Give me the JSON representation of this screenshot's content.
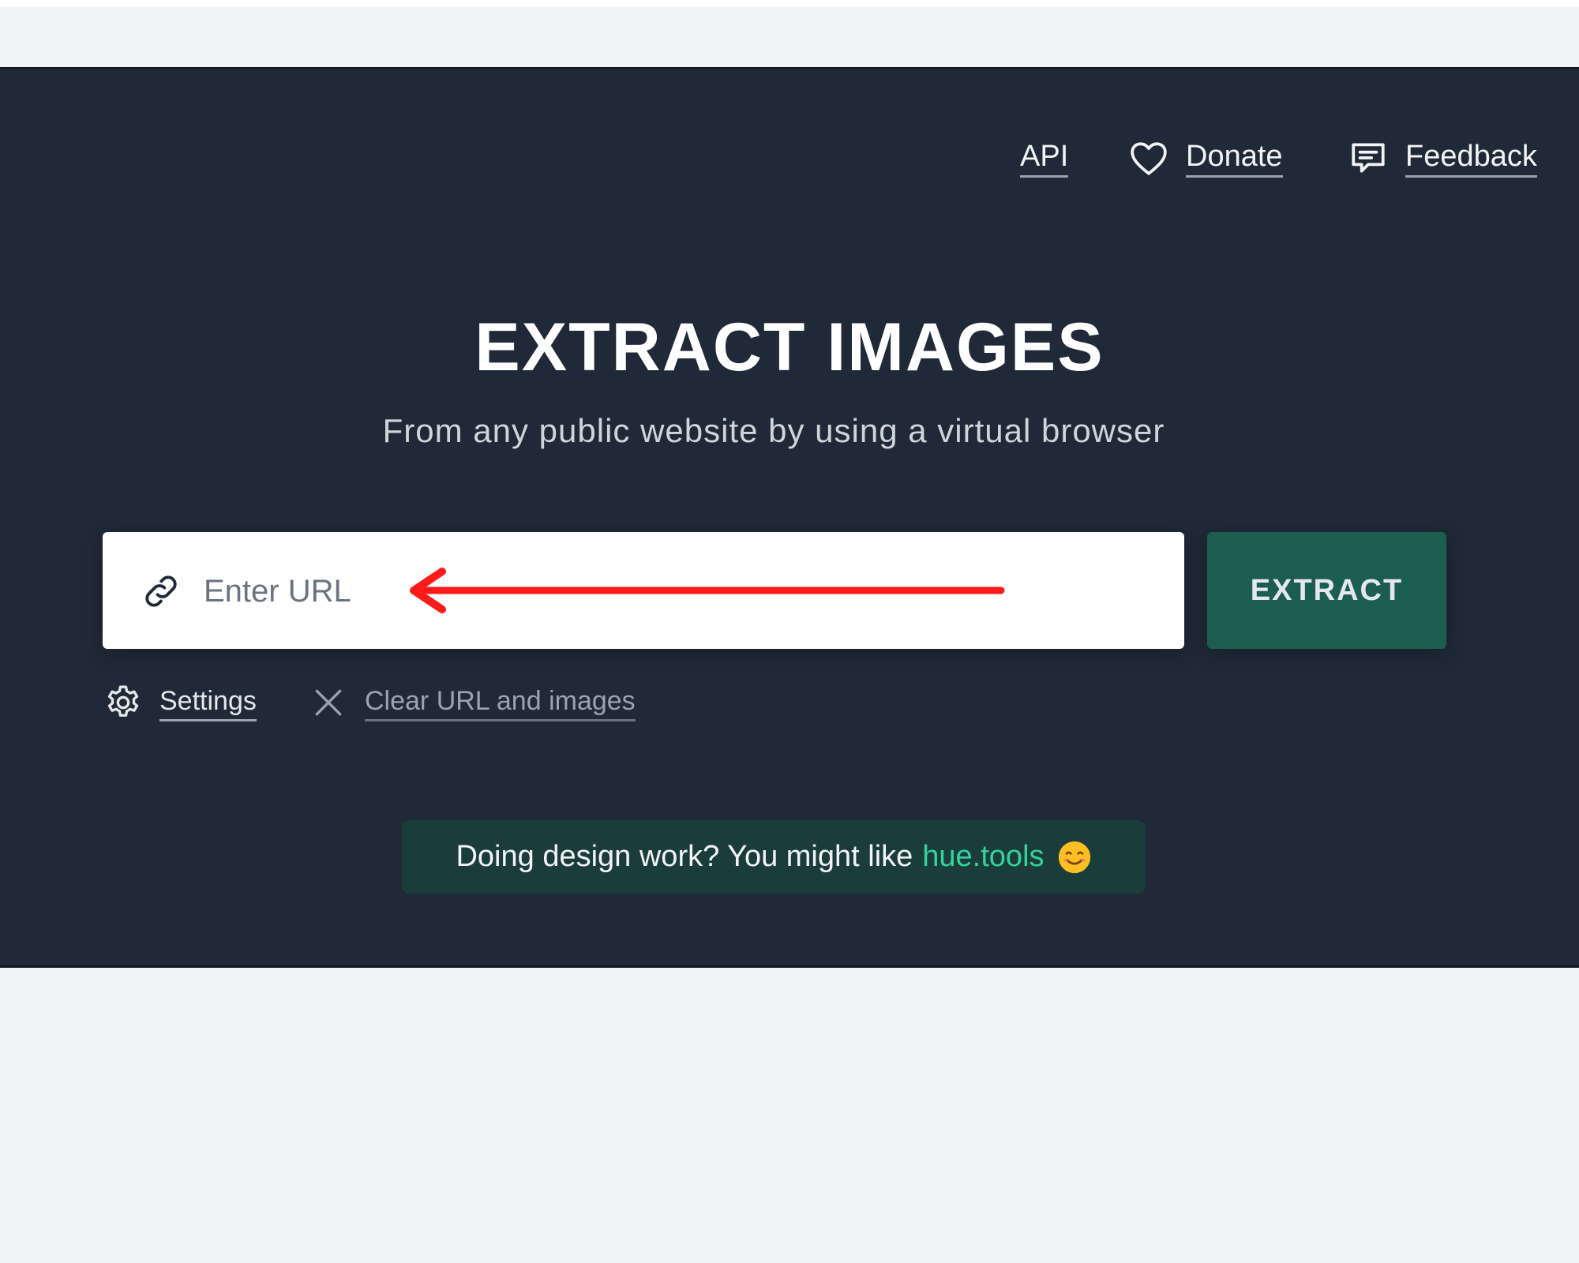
{
  "nav": {
    "api_label": "API",
    "donate_label": "Donate",
    "feedback_label": "Feedback"
  },
  "hero": {
    "title": "EXTRACT IMAGES",
    "subtitle": "From any public website by using a virtual browser"
  },
  "url_form": {
    "placeholder": "Enter URL",
    "value": "",
    "extract_label": "EXTRACT",
    "icon": "link-icon"
  },
  "options": {
    "settings_label": "Settings",
    "settings_icon": "gear-icon",
    "clear_label": "Clear URL and images",
    "clear_icon": "close-icon"
  },
  "promo": {
    "text": "Doing design work? You might like",
    "link_text": "hue.tools",
    "emoji_icon": "smiling-face-icon"
  },
  "annotation": {
    "arrow_color": "#ff1a1a",
    "arrow_direction": "left",
    "arrow_icon": "red-arrow-icon"
  },
  "colors": {
    "hero_bg": "#1f2937",
    "page_bg": "#f2f3f5",
    "extract_button": "#1b5e4f",
    "promo_bg": "#1a3d3b",
    "promo_link": "#34d399"
  }
}
